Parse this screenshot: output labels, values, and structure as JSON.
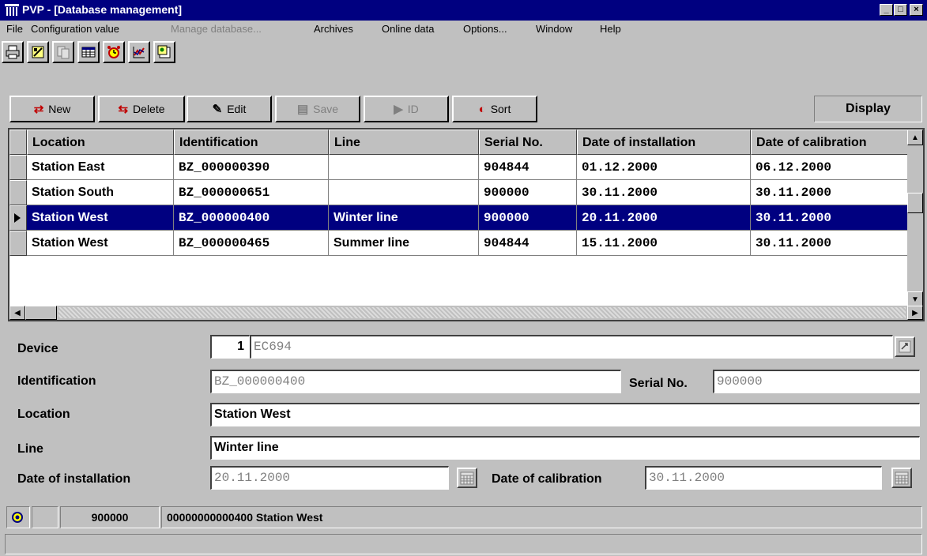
{
  "window": {
    "title": "PVP - [Database management]",
    "minimize": "_",
    "maximize": "□",
    "close": "×"
  },
  "menu": [
    {
      "label": "File",
      "enabled": true
    },
    {
      "label": "Configuration value",
      "enabled": true
    },
    {
      "label": "Manage database...",
      "enabled": false
    },
    {
      "label": "Archives",
      "enabled": true
    },
    {
      "label": "Online data",
      "enabled": true
    },
    {
      "label": "Options...",
      "enabled": true
    },
    {
      "label": "Window",
      "enabled": true
    },
    {
      "label": "Help",
      "enabled": true
    }
  ],
  "toolbar_icons": [
    "printer-icon",
    "device-edit-icon",
    "copy-icon",
    "table-icon",
    "alarm-clock-icon",
    "chart-icon",
    "archive-icon"
  ],
  "actions": {
    "new": "New",
    "delete": "Delete",
    "edit": "Edit",
    "save": "Save",
    "id": "ID",
    "sort": "Sort",
    "display": "Display"
  },
  "grid": {
    "columns": [
      "Location",
      "Identification",
      "Line",
      "Serial No.",
      "Date of installation",
      "Date of calibration"
    ],
    "rows": [
      [
        "Station East",
        "BZ_000000390",
        "",
        "904844",
        "01.12.2000",
        "06.12.2000"
      ],
      [
        "Station South",
        "BZ_000000651",
        "",
        "900000",
        "30.11.2000",
        "30.11.2000"
      ],
      [
        "Station West",
        "BZ_000000400",
        "Winter line",
        "900000",
        "20.11.2000",
        "30.11.2000"
      ],
      [
        "Station West",
        "BZ_000000465",
        "Summer line",
        "904844",
        "15.11.2000",
        "30.11.2000"
      ]
    ],
    "selected_row": 2
  },
  "form": {
    "device_label": "Device",
    "device_number": "1",
    "device_value": "EC694",
    "identification_label": "Identification",
    "identification_value": "BZ_000000400",
    "serial_label": "Serial No.",
    "serial_value": "900000",
    "location_label": "Location",
    "location_value": "Station West",
    "line_label": "Line",
    "line_value": "Winter line",
    "installation_label": "Date of installation",
    "installation_value": "20.11.2000",
    "calibration_label": "Date of calibration",
    "calibration_value": "30.11.2000"
  },
  "status": {
    "serial": "900000",
    "identifier": "00000000000400",
    "location": "Station West"
  }
}
